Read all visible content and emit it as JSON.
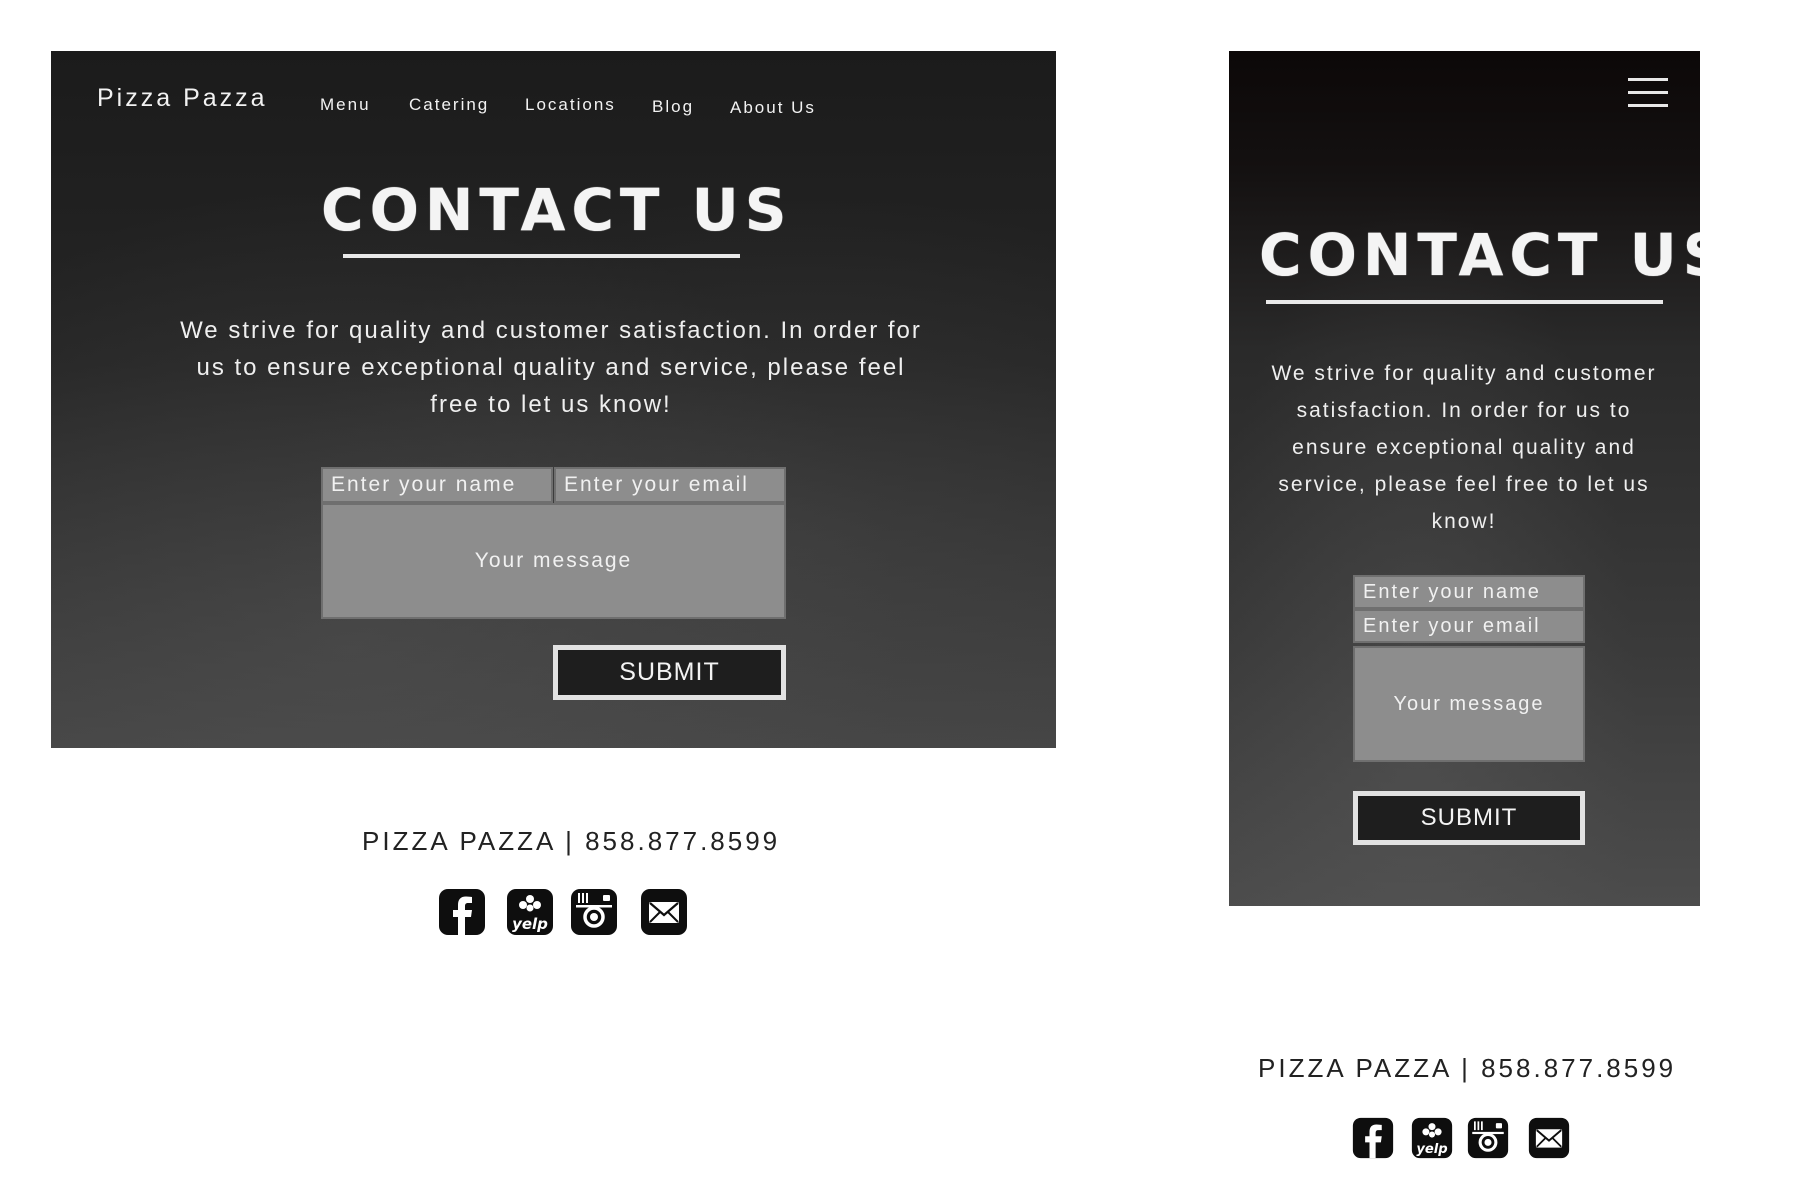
{
  "site": {
    "brand": "Pizza Pazza"
  },
  "nav": [
    {
      "label": "Menu"
    },
    {
      "label": "Catering"
    },
    {
      "label": "Locations"
    },
    {
      "label": "Blog"
    },
    {
      "label": "About Us"
    }
  ],
  "contact": {
    "heading": "CONTACT US",
    "intro": "We strive for quality and customer satisfaction. In order for us to ensure exceptional quality and service, please feel free to let us know!",
    "form": {
      "name_placeholder": "Enter your name",
      "email_placeholder": "Enter your email",
      "message_placeholder": "Your message",
      "submit_label": "SUBMIT"
    }
  },
  "footer": {
    "line": "PIZZA PAZZA | 858.877.8599",
    "social_icons": [
      "facebook-icon",
      "yelp-icon",
      "instagram-icon",
      "email-icon"
    ],
    "yelp_text": "yelp"
  },
  "colors": {
    "panel_dark": "#1b1b1b",
    "field_gray": "#8d8d8d",
    "text_light": "#f2f2f2",
    "footer_text": "#222222"
  }
}
